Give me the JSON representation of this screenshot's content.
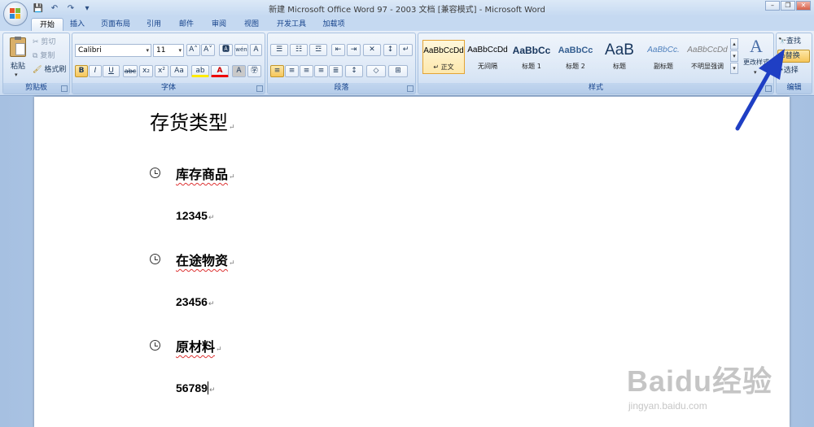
{
  "window": {
    "title": "新建 Microsoft Office Word 97 - 2003 文档 [兼容模式] - Microsoft Word",
    "qat": {
      "save": "💾",
      "undo": "↶",
      "redo": "↷",
      "customize": "▾"
    },
    "controls": {
      "minimize": "–",
      "maximize": "❐",
      "close": "✕"
    }
  },
  "tabs": [
    "开始",
    "插入",
    "页面布局",
    "引用",
    "邮件",
    "审阅",
    "视图",
    "开发工具",
    "加载项"
  ],
  "clipboard": {
    "paste": "粘贴",
    "cut": "剪切",
    "copy": "复制",
    "format_painter": "格式刷",
    "label": "剪贴板"
  },
  "font": {
    "name": "Calibri",
    "size": "11",
    "grow": "A˄",
    "shrink": "A˅",
    "clear": "🅰",
    "phonetic": "wén",
    "char_border": "A",
    "bold": "B",
    "italic": "I",
    "underline": "U",
    "strike": "abc",
    "subscript": "x₂",
    "superscript": "x²",
    "change_case": "Aa",
    "highlight": "ab",
    "font_color": "A",
    "char_shading": "A",
    "enclose": "㊫",
    "label": "字体"
  },
  "paragraph": {
    "row1": [
      "☰",
      "☷",
      "☲",
      "⇤",
      "⇥",
      "✕",
      "↕",
      "↵"
    ],
    "row2": [
      "≡",
      "≡",
      "≡",
      "≡",
      "≣",
      "↕",
      "◇",
      "⊞"
    ],
    "label": "段落"
  },
  "styles": {
    "items": [
      {
        "preview": "AaBbCcDd",
        "name": "↵ 正文"
      },
      {
        "preview": "AaBbCcDd",
        "name": "无间隔"
      },
      {
        "preview": "AaBbCc",
        "name": "标题 1"
      },
      {
        "preview": "AaBbCc",
        "name": "标题 2"
      },
      {
        "preview": "AaB",
        "name": "标题"
      },
      {
        "preview": "AaBbCc.",
        "name": "副标题"
      },
      {
        "preview": "AaBbCcDd",
        "name": "不明显强调"
      }
    ],
    "change_styles": "更改样式",
    "label": "样式"
  },
  "editing": {
    "find": "查找",
    "replace": "替换",
    "select": "选择",
    "label": "编辑"
  },
  "document": {
    "heading": "存货类型",
    "items": [
      {
        "name": "库存商品",
        "value": "12345"
      },
      {
        "name": "在途物资",
        "value": "23456"
      },
      {
        "name": "原材料",
        "value": "56789"
      }
    ],
    "paragraph_mark": "↵"
  },
  "watermark": {
    "brand": "Baidu经验",
    "url": "jingyan.baidu.com"
  },
  "colors": {
    "arrow": "#1f3fc4",
    "selected_style": "#e3a435"
  }
}
